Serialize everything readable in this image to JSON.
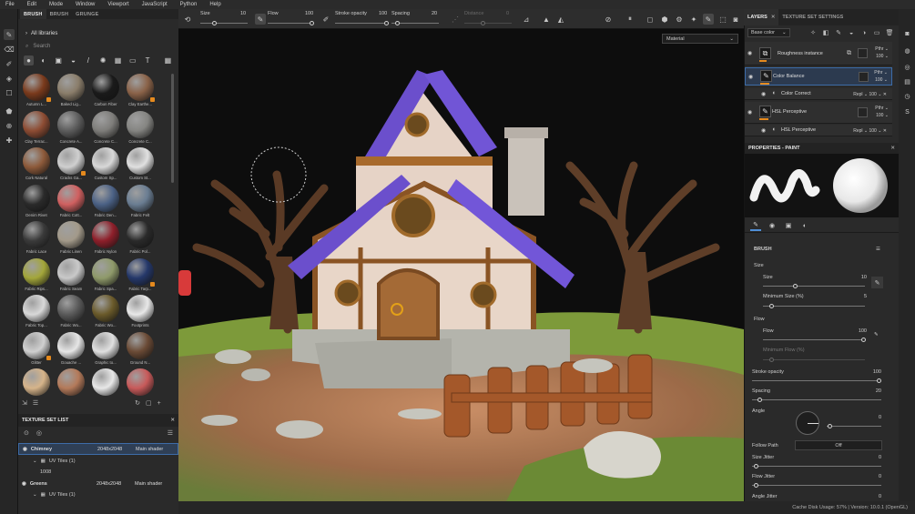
{
  "menubar": {
    "items": [
      "File",
      "Edit",
      "Mode",
      "Window",
      "Viewport",
      "JavaScript",
      "Python",
      "Help"
    ]
  },
  "shelf": {
    "tabs": [
      "BRUSH",
      "BRUSH",
      "GRUNGE"
    ],
    "library": "All libraries",
    "search_placeholder": "Search",
    "materials": [
      {
        "name": "Autumn L...",
        "color": "#7a3a1c",
        "dot": true
      },
      {
        "name": "Baked Lig...",
        "color": "#8a7d6a",
        "dot": false
      },
      {
        "name": "Carbon Fiber",
        "color": "#1a1a1a",
        "dot": false
      },
      {
        "name": "Clay Earthe...",
        "color": "#8a6248",
        "dot": true
      },
      {
        "name": "Clay Terrac...",
        "color": "#8d4c33",
        "dot": false
      },
      {
        "name": "Concrete A...",
        "color": "#5d5d5d",
        "dot": false
      },
      {
        "name": "Concrete C...",
        "color": "#7e7d7a",
        "dot": false
      },
      {
        "name": "Concrete C...",
        "color": "#858582",
        "dot": false
      },
      {
        "name": "Cork Natural",
        "color": "#8d5a3a",
        "dot": false
      },
      {
        "name": "Cracks Ga...",
        "color": "#cfcfcf",
        "dot": true
      },
      {
        "name": "Custom Sp...",
        "color": "#d8d8d8",
        "dot": false
      },
      {
        "name": "Custom St...",
        "color": "#e0e0e0",
        "dot": false
      },
      {
        "name": "Denim Rivet",
        "color": "#2a2a2a",
        "dot": false
      },
      {
        "name": "Fabric Cott...",
        "color": "#d06060",
        "dot": false
      },
      {
        "name": "Fabric Den...",
        "color": "#4b6185",
        "dot": false
      },
      {
        "name": "Fabric Felt",
        "color": "#6a7d92",
        "dot": false
      },
      {
        "name": "Fabric Lace",
        "color": "#3a3a3a",
        "dot": false
      },
      {
        "name": "Fabric Linen",
        "color": "#a39a8a",
        "dot": false
      },
      {
        "name": "Fabric Nylon",
        "color": "#8e1f2a",
        "dot": false
      },
      {
        "name": "Fabric Pol...",
        "color": "#2a2a2a",
        "dot": false
      },
      {
        "name": "Fabric Rips...",
        "color": "#a3a63a",
        "dot": false
      },
      {
        "name": "Fabric Seam",
        "color": "#c9c9c9",
        "dot": false
      },
      {
        "name": "Fabric Spa...",
        "color": "#8f9a6a",
        "dot": false
      },
      {
        "name": "Fabric Tarp...",
        "color": "#25386a",
        "dot": true
      },
      {
        "name": "Fabric Top...",
        "color": "#d8d8d8",
        "dot": false
      },
      {
        "name": "Fabric Wo...",
        "color": "#5a5a5a",
        "dot": false
      },
      {
        "name": "Fabric Wo...",
        "color": "#6a5a2a",
        "dot": false
      },
      {
        "name": "Footprints",
        "color": "#e8e8e8",
        "dot": false
      },
      {
        "name": "Glitter",
        "color": "#d0d0d0",
        "dot": true
      },
      {
        "name": "Gouache ...",
        "color": "#e6e6e6",
        "dot": false
      },
      {
        "name": "Graphic to...",
        "color": "#e0e0e0",
        "dot": false
      },
      {
        "name": "Ground N...",
        "color": "#6a4a35",
        "dot": false
      },
      {
        "name": "",
        "color": "#d6b48a",
        "dot": false
      },
      {
        "name": "",
        "color": "#b47a5a",
        "dot": false
      },
      {
        "name": "",
        "color": "#e8e8e8",
        "dot": false
      },
      {
        "name": "",
        "color": "#c85a5a",
        "dot": false
      }
    ]
  },
  "texture_set_list": {
    "title": "TEXTURE SET LIST",
    "rows": [
      {
        "name": "Chimney",
        "size": "2048x2048",
        "shader": "Main shader",
        "selected": true
      },
      {
        "name": "Greens",
        "size": "2048x2048",
        "shader": "Main shader",
        "selected": false
      }
    ],
    "uv_label": "UV Tiles (1)",
    "tile_id": "1008"
  },
  "topbar": {
    "size_label": "Size",
    "size_value": "10",
    "flow_label": "Flow",
    "flow_value": "100",
    "stroke_label": "Stroke opacity",
    "stroke_value": "100",
    "spacing_label": "Spacing",
    "spacing_value": "20",
    "distance_label": "Distance",
    "distance_value": "0"
  },
  "viewport": {
    "material_mode": "Material"
  },
  "layers_panel": {
    "tabs": [
      "LAYERS",
      "TEXTURE SET SETTINGS"
    ],
    "channel": "Base color",
    "layers": [
      {
        "name": "Roughness instance",
        "blend": "Pthr",
        "opacity": "100",
        "icon": "⧉"
      },
      {
        "name": "Color Balance",
        "blend": "Pthr",
        "opacity": "100",
        "icon": "✎"
      },
      {
        "name": "Color Correct",
        "blend": "Repl",
        "opacity": "100",
        "icon": "◐"
      },
      {
        "name": "HSL Perceptive",
        "blend": "Pthr",
        "opacity": "100",
        "icon": "✎"
      },
      {
        "name": "HSL Perceptive",
        "blend": "Repl",
        "opacity": "100",
        "icon": "◐"
      }
    ]
  },
  "properties": {
    "title": "PROPERTIES - PAINT",
    "section": "BRUSH",
    "size_group": "Size",
    "size_label": "Size",
    "size_value": "10",
    "min_size_label": "Minimum Size (%)",
    "min_size_value": "5",
    "flow_group": "Flow",
    "flow_label": "Flow",
    "flow_value": "100",
    "min_flow_label": "Minimum Flow (%)",
    "stroke_label": "Stroke opacity",
    "stroke_value": "100",
    "spacing_label": "Spacing",
    "spacing_value": "20",
    "angle_label": "Angle",
    "angle_value": "0",
    "follow_path_label": "Follow Path",
    "follow_path_value": "Off",
    "size_jitter_label": "Size Jitter",
    "size_jitter_value": "0",
    "flow_jitter_label": "Flow Jitter",
    "flow_jitter_value": "0",
    "angle_jitter_label": "Angle Jitter",
    "angle_jitter_value": "0"
  },
  "status": {
    "text": "Cache Disk Usage:   57%  |  Version: 10.0.1 (OpenGL)"
  },
  "colors": {
    "accent": "#e58a1e",
    "selection": "#3d6ca8",
    "panel": "#2a2a2a"
  }
}
